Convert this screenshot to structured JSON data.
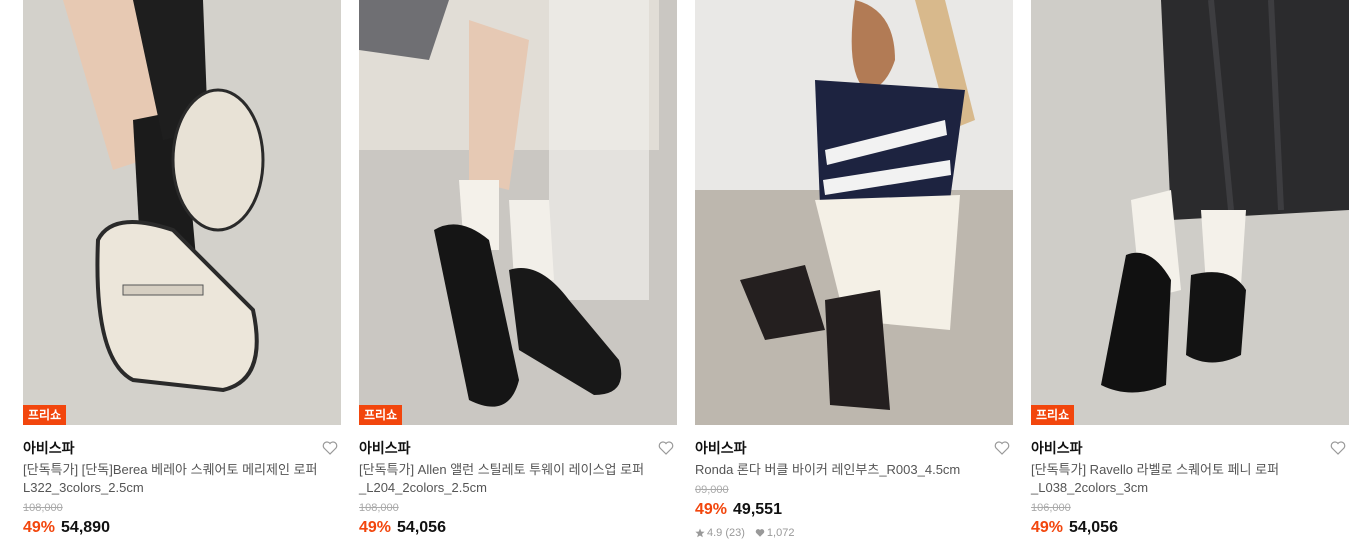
{
  "colors": {
    "accent": "#f2460d",
    "strike": "#aaaaaa"
  },
  "products": [
    {
      "badge": "프리쇼",
      "brand": "아비스파",
      "title_line1": "[단독특가] [단독]Berea 베레아 스퀘어토 메리제인 로퍼",
      "title_line2": "L322_3colors_2.5cm",
      "original_price": "108,000",
      "discount": "49%",
      "price": "54,890",
      "image_icon": "mary-jane-loafer-photo"
    },
    {
      "badge": "프리쇼",
      "brand": "아비스파",
      "title_line1": "[단독특가] Allen 앨런 스틸레토 투웨이 레이스업 로퍼",
      "title_line2": "_L204_2colors_2.5cm",
      "original_price": "108,000",
      "discount": "49%",
      "price": "54,056",
      "image_icon": "lace-up-loafer-photo"
    },
    {
      "badge": "",
      "brand": "아비스파",
      "title_line1": "Ronda 론다 버클 바이커 레인부츠_R003_4.5cm",
      "title_line2": "",
      "original_price": "09,000",
      "discount": "49%",
      "price": "49,551",
      "rating": "4.9 (23)",
      "likes": "1,072",
      "image_icon": "biker-rain-boots-photo"
    },
    {
      "badge": "프리쇼",
      "brand": "아비스파",
      "title_line1": "[단독특가] Ravello 라벨로 스퀘어토 페니 로퍼",
      "title_line2": "_L038_2colors_3cm",
      "original_price": "106,000",
      "discount": "49%",
      "price": "54,056",
      "image_icon": "penny-loafer-photo"
    }
  ]
}
